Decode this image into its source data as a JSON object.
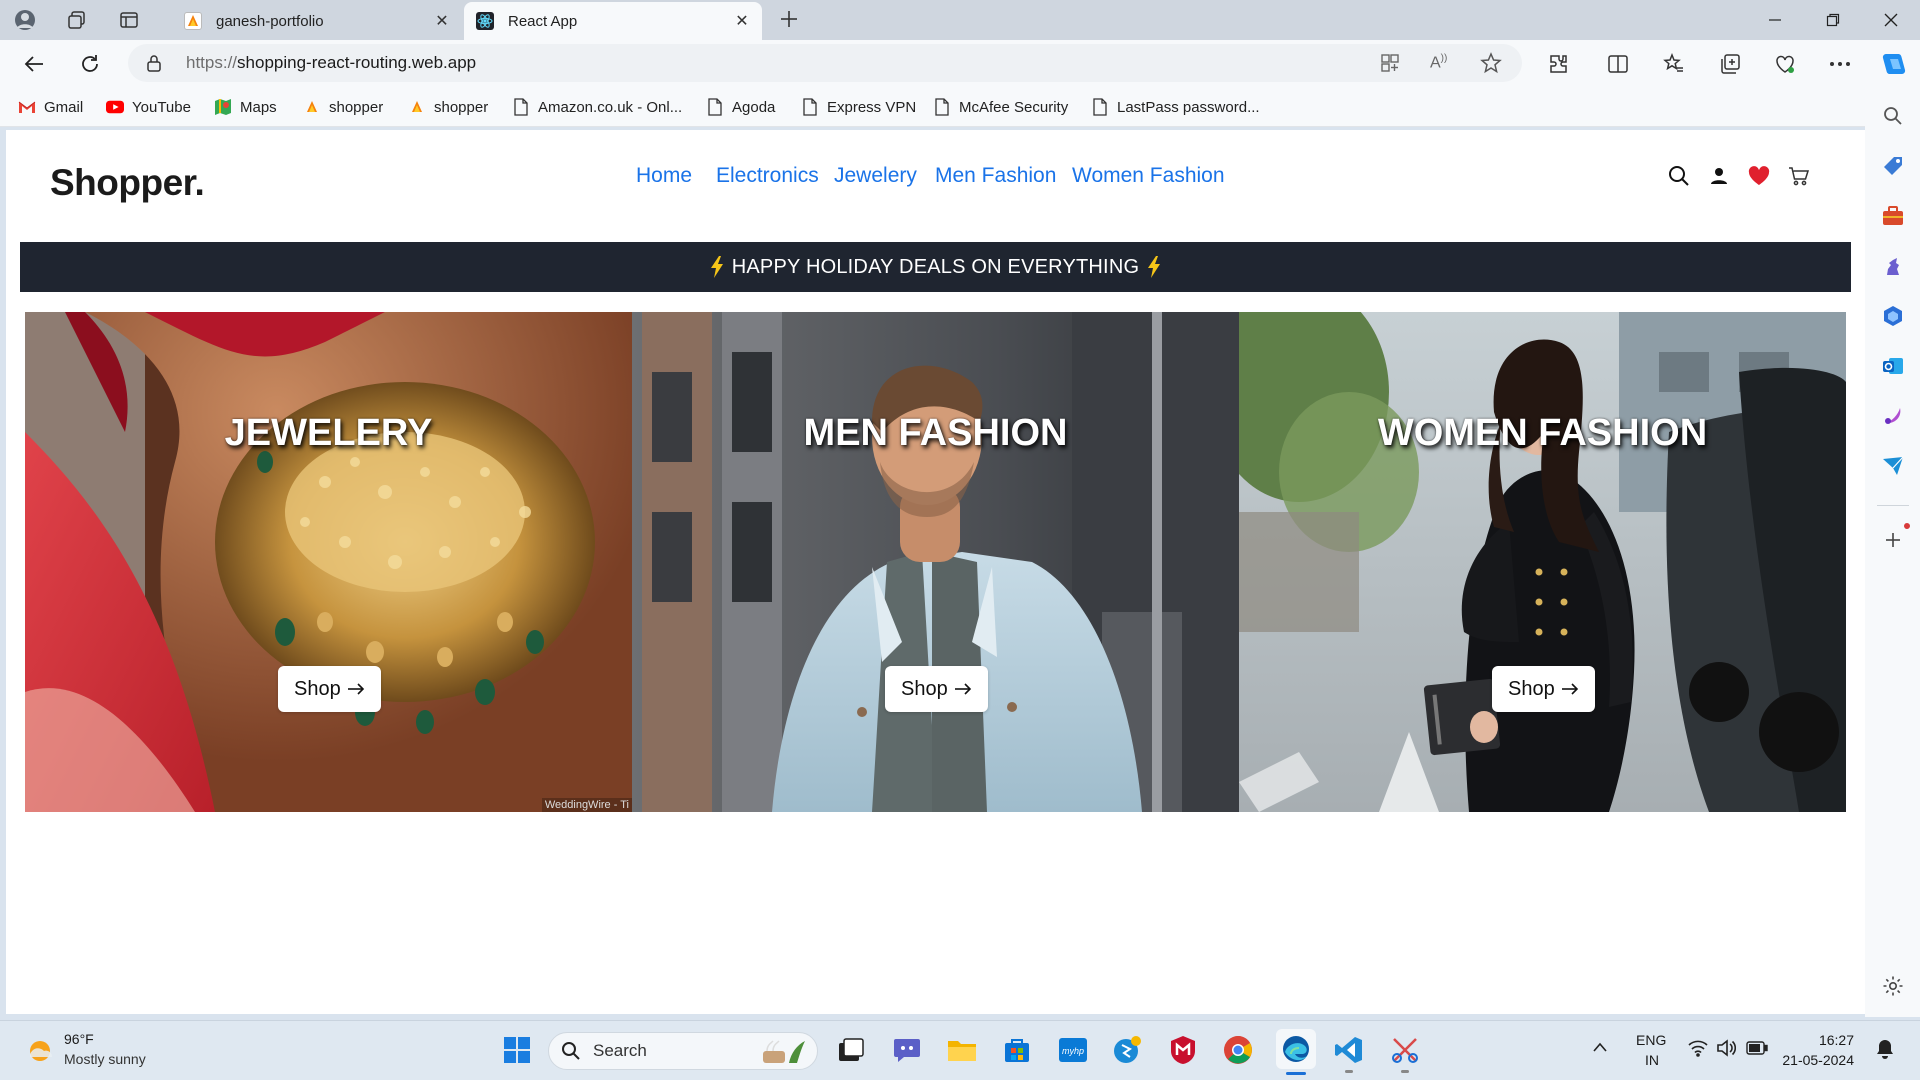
{
  "browser": {
    "tabs": [
      {
        "title": "ganesh-portfolio",
        "active": false
      },
      {
        "title": "React App",
        "active": true
      }
    ],
    "url": {
      "protocol": "https://",
      "host": "shopping-react-routing.web.app"
    },
    "bookmarks": [
      {
        "label": "Gmail",
        "icon": "gmail-icon"
      },
      {
        "label": "YouTube",
        "icon": "youtube-icon"
      },
      {
        "label": "Maps",
        "icon": "maps-icon"
      },
      {
        "label": "shopper",
        "icon": "firebase-icon"
      },
      {
        "label": "shopper",
        "icon": "firebase-icon"
      },
      {
        "label": "Amazon.co.uk - Onl...",
        "icon": "page-icon"
      },
      {
        "label": "Agoda",
        "icon": "page-icon"
      },
      {
        "label": "Express VPN",
        "icon": "page-icon"
      },
      {
        "label": "McAfee Security",
        "icon": "page-icon"
      },
      {
        "label": "LastPass password...",
        "icon": "page-icon"
      }
    ]
  },
  "site": {
    "brand": "Shopper.",
    "nav": [
      "Home",
      "Electronics",
      "Jewelery",
      "Men Fashion",
      "Women Fashion"
    ],
    "banner": "HAPPY HOLIDAY DEALS ON EVERYTHING",
    "cards": [
      {
        "title": "JEWELERY",
        "button": "Shop",
        "credit": "WeddingWire - Ti"
      },
      {
        "title": "MEN FASHION",
        "button": "Shop"
      },
      {
        "title": "WOMEN FASHION",
        "button": "Shop"
      }
    ]
  },
  "taskbar": {
    "weather": {
      "temp": "96°F",
      "desc": "Mostly sunny"
    },
    "search_placeholder": "Search",
    "lang": {
      "line1": "ENG",
      "line2": "IN"
    },
    "clock": {
      "time": "16:27",
      "date": "21-05-2024"
    }
  },
  "colors": {
    "nav_link": "#1a73e8",
    "banner_bg": "#1f2530",
    "heart": "#e0202e",
    "bolt": "#f5c518"
  }
}
